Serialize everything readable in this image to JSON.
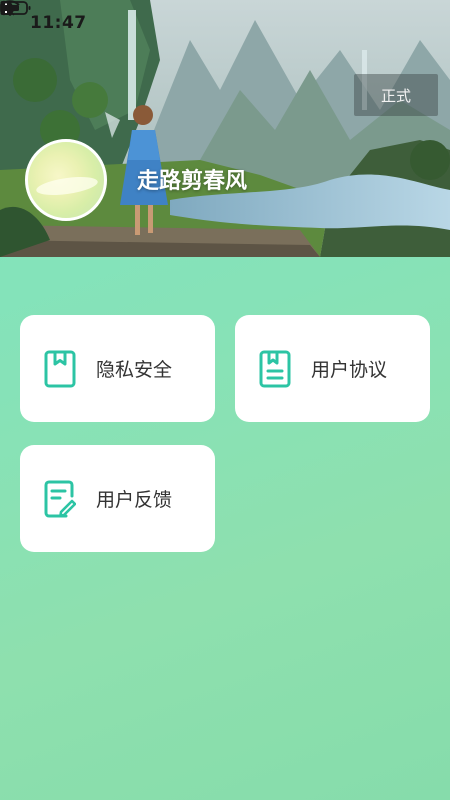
{
  "status_bar": {
    "time": "11:47",
    "icons": [
      "bluetooth-icon",
      "mute-bell-icon",
      "wifi-icon",
      "alert-icon",
      "battery-icon"
    ]
  },
  "header": {
    "env_badge": "正式",
    "username": "走路剪春风"
  },
  "menu": {
    "items": [
      {
        "label": "隐私安全",
        "icon": "bookmark-document-icon"
      },
      {
        "label": "用户协议",
        "icon": "agreement-document-icon"
      },
      {
        "label": "用户反馈",
        "icon": "feedback-edit-icon"
      }
    ]
  },
  "colors": {
    "accent": "#2cc4a4",
    "background_top": "#7ee6c0",
    "background_bottom": "#86dcab",
    "card": "#ffffff"
  }
}
